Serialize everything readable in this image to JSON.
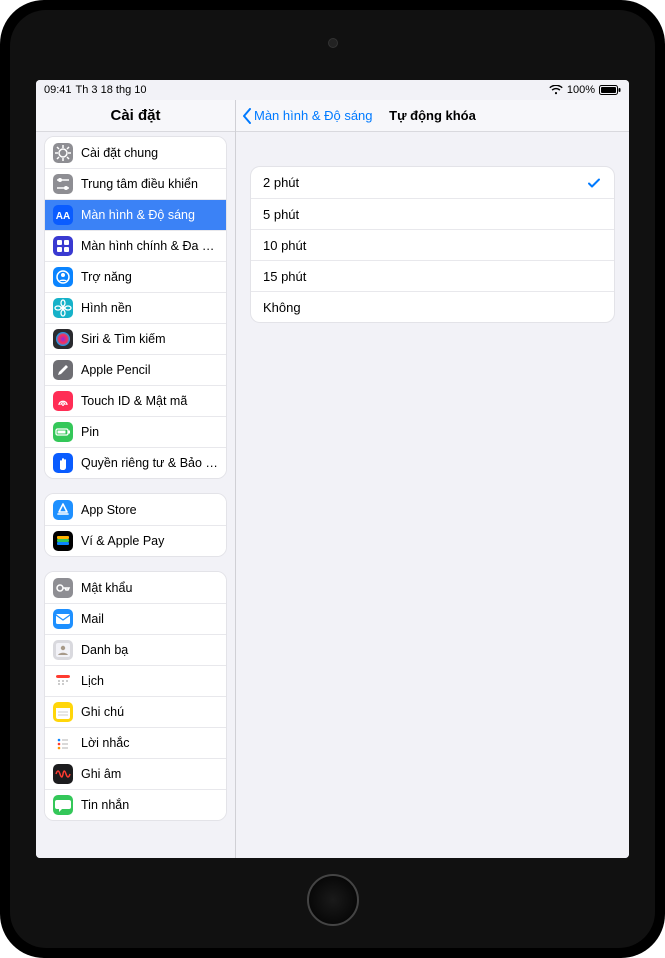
{
  "status": {
    "time": "09:41",
    "date": "Th 3 18 thg 10",
    "battery_pct": "100%"
  },
  "sidebar": {
    "title": "Cài đặt",
    "groups": [
      {
        "items": [
          {
            "id": "general",
            "label": "Cài đặt chung",
            "bg": "#8e8e93",
            "glyph": "gear"
          },
          {
            "id": "control",
            "label": "Trung tâm điều khiển",
            "bg": "#8e8e93",
            "glyph": "sliders"
          },
          {
            "id": "display",
            "label": "Màn hình & Độ sáng",
            "bg": "#0a5cff",
            "glyph": "AA",
            "selected": true
          },
          {
            "id": "home",
            "label": "Màn hình chính & Đa nhiệm",
            "bg": "#3a3ad1",
            "glyph": "grid"
          },
          {
            "id": "accessibility",
            "label": "Trợ năng",
            "bg": "#0a84ff",
            "glyph": "person"
          },
          {
            "id": "wallpaper",
            "label": "Hình nền",
            "bg": "#16b2c9",
            "glyph": "flower"
          },
          {
            "id": "siri",
            "label": "Siri & Tìm kiếm",
            "bg": "#2a2a2e",
            "glyph": "siri"
          },
          {
            "id": "pencil",
            "label": "Apple Pencil",
            "bg": "#6e6e73",
            "glyph": "pencil"
          },
          {
            "id": "touchid",
            "label": "Touch ID & Mật mã",
            "bg": "#ff2d55",
            "glyph": "finger"
          },
          {
            "id": "battery",
            "label": "Pin",
            "bg": "#34c759",
            "glyph": "battery"
          },
          {
            "id": "privacy",
            "label": "Quyền riêng tư & Bảo mật",
            "bg": "#0a5cff",
            "glyph": "hand"
          }
        ]
      },
      {
        "items": [
          {
            "id": "appstore",
            "label": "App Store",
            "bg": "#1e90ff",
            "glyph": "appstore"
          },
          {
            "id": "wallet",
            "label": "Ví & Apple Pay",
            "bg": "#000000",
            "glyph": "wallet"
          }
        ]
      },
      {
        "items": [
          {
            "id": "passwords",
            "label": "Mật khẩu",
            "bg": "#8e8e93",
            "glyph": "key"
          },
          {
            "id": "mail",
            "label": "Mail",
            "bg": "#1e90ff",
            "glyph": "mail"
          },
          {
            "id": "contacts",
            "label": "Danh bạ",
            "bg": "#d9d9de",
            "glyph": "contacts"
          },
          {
            "id": "calendar",
            "label": "Lịch",
            "bg": "#ffffff",
            "glyph": "calendar"
          },
          {
            "id": "notes",
            "label": "Ghi chú",
            "bg": "#ffd60a",
            "glyph": "notes"
          },
          {
            "id": "reminders",
            "label": "Lời nhắc",
            "bg": "#ffffff",
            "glyph": "reminders"
          },
          {
            "id": "voice",
            "label": "Ghi âm",
            "bg": "#1c1c1e",
            "glyph": "voice"
          },
          {
            "id": "messages",
            "label": "Tin nhắn",
            "bg": "#34c759",
            "glyph": "bubble"
          }
        ]
      }
    ]
  },
  "detail": {
    "back_label": "Màn hình & Độ sáng",
    "title": "Tự động khóa",
    "options": [
      {
        "label": "2 phút",
        "checked": true
      },
      {
        "label": "5 phút",
        "checked": false
      },
      {
        "label": "10 phút",
        "checked": false
      },
      {
        "label": "15 phút",
        "checked": false
      },
      {
        "label": "Không",
        "checked": false
      }
    ]
  }
}
